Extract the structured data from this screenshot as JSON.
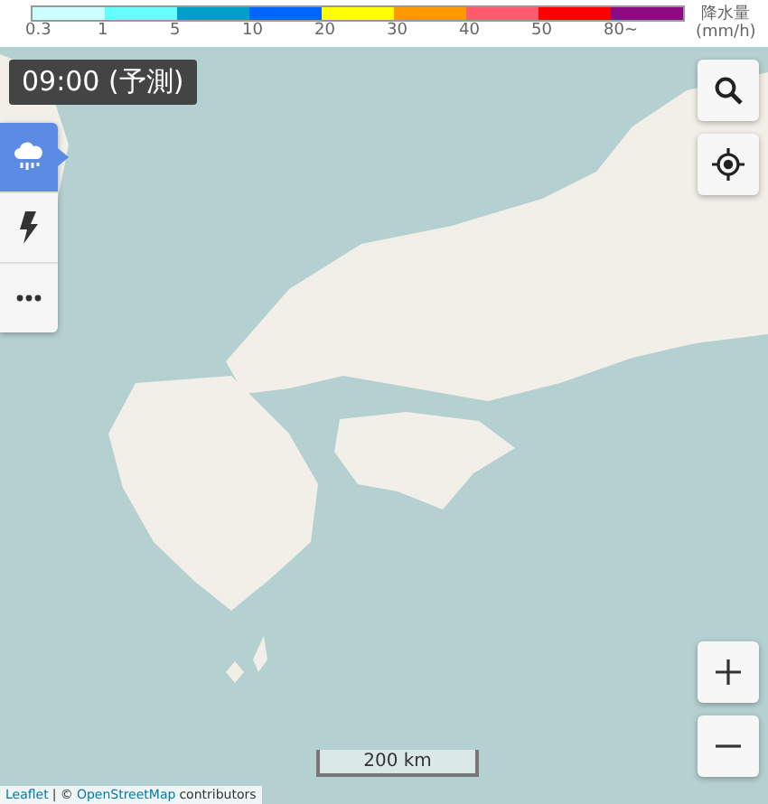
{
  "legend": {
    "steps": [
      {
        "color": "#ccffff",
        "label": "0.3"
      },
      {
        "color": "#66ffff",
        "label": "1"
      },
      {
        "color": "#00a0c8",
        "label": "5"
      },
      {
        "color": "#0064ff",
        "label": "10"
      },
      {
        "color": "#ffff00",
        "label": "20"
      },
      {
        "color": "#ff9900",
        "label": "30"
      },
      {
        "color": "#ff5a6e",
        "label": "40"
      },
      {
        "color": "#ff0000",
        "label": "50"
      },
      {
        "color": "#8c0a82",
        "label": "80~"
      }
    ],
    "title": "降水量",
    "unit": "(mm/h)"
  },
  "time_badge": "09:00 (予測)",
  "layer_tabs": [
    {
      "kind": "rain",
      "selected": true
    },
    {
      "kind": "lightning",
      "selected": false
    },
    {
      "kind": "more",
      "selected": false
    }
  ],
  "scale": "200 km",
  "attribution": {
    "library_link": "Leaflet",
    "separator": "| ©",
    "map_link": "OpenStreetMap",
    "suffix": "contributors"
  }
}
